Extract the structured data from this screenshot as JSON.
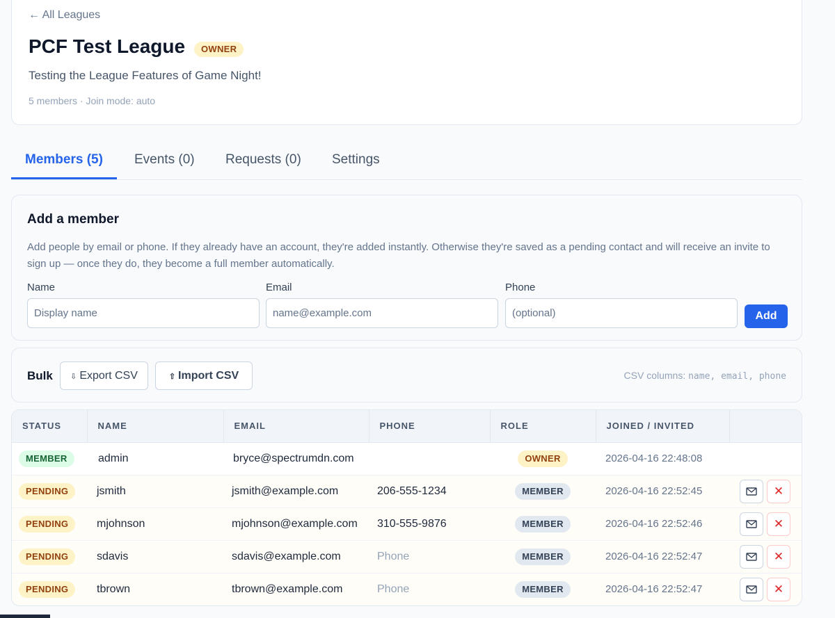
{
  "header": {
    "back_label": "← All Leagues",
    "title": "PCF Test League",
    "badge": "OWNER",
    "description": "Testing the League Features of Game Night!",
    "meta": "5 members · Join mode: auto"
  },
  "tabs": [
    {
      "label": "Members (5)",
      "active": true
    },
    {
      "label": "Events (0)",
      "active": false
    },
    {
      "label": "Requests (0)",
      "active": false
    },
    {
      "label": "Settings",
      "active": false
    }
  ],
  "add_member": {
    "title": "Add a member",
    "description": "Add people by email or phone. If they already have an account, they're added instantly. Otherwise they're saved as a pending contact and will receive an invite to sign up — once they do, they become a full member automatically.",
    "name_label": "Name",
    "name_placeholder": "Display name",
    "email_label": "Email",
    "email_placeholder": "name@example.com",
    "phone_label": "Phone",
    "phone_placeholder": "(optional)",
    "add_label": "Add"
  },
  "bulk": {
    "label": "Bulk",
    "export_label": "Export CSV",
    "import_label": "Import CSV",
    "hint_prefix": "CSV columns:",
    "hint_columns": "name, email, phone"
  },
  "table": {
    "headers": [
      "STATUS",
      "NAME",
      "EMAIL",
      "PHONE",
      "ROLE",
      "JOINED / INVITED",
      ""
    ],
    "rows": [
      {
        "status": "MEMBER",
        "name": "admin",
        "email": "bryce@spectrumdn.com",
        "phone": "",
        "role": "OWNER",
        "joined": "2026-04-16 22:48:08"
      },
      {
        "status": "PENDING",
        "name": "jsmith",
        "email": "jsmith@example.com",
        "phone": "206-555-1234",
        "role": "MEMBER",
        "joined": "2026-04-16 22:52:45"
      },
      {
        "status": "PENDING",
        "name": "mjohnson",
        "email": "mjohnson@example.com",
        "phone": "310-555-9876",
        "role": "MEMBER",
        "joined": "2026-04-16 22:52:46"
      },
      {
        "status": "PENDING",
        "name": "sdavis",
        "email": "sdavis@example.com",
        "phone": "Phone",
        "role": "MEMBER",
        "joined": "2026-04-16 22:52:47"
      },
      {
        "status": "PENDING",
        "name": "tbrown",
        "email": "tbrown@example.com",
        "phone": "Phone",
        "role": "MEMBER",
        "joined": "2026-04-16 22:52:47"
      }
    ],
    "resend_icon": "mail-icon",
    "remove_icon": "close-icon",
    "remove_glyph": "✕"
  },
  "colors": {
    "accent": "#2563eb",
    "member_badge": "#dcfce7",
    "pending_badge": "#fef3c7",
    "danger": "#dc2626"
  }
}
